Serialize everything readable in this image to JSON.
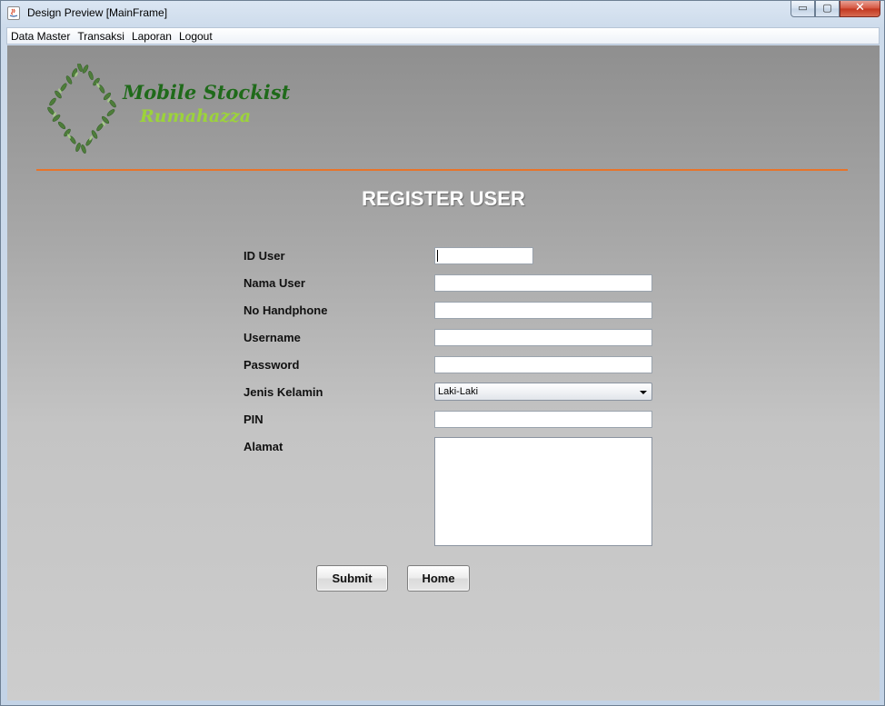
{
  "window": {
    "title": "Design Preview [MainFrame]",
    "controls": {
      "minimize": "▭",
      "maximize": "▢",
      "close": "✕"
    }
  },
  "menubar": {
    "items": [
      "Data Master",
      "Transaksi",
      "Laporan",
      "Logout"
    ]
  },
  "branding": {
    "line1": "Mobile Stockist",
    "line2": "Rumahazza",
    "colors": {
      "line1": "#1f6a1a",
      "line2": "#9cd33a",
      "divider": "#e8742a"
    },
    "logo_icon": "leaf-wreath-icon"
  },
  "form": {
    "title": "REGISTER USER",
    "labels": {
      "id_user": "ID User",
      "nama_user": "Nama User",
      "no_handphone": "No Handphone",
      "username": "Username",
      "password": "Password",
      "jenis_kelamin": "Jenis Kelamin",
      "pin": "PIN",
      "alamat": "Alamat"
    },
    "values": {
      "id_user": "",
      "nama_user": "",
      "no_handphone": "",
      "username": "",
      "password": "",
      "jenis_kelamin": "Laki-Laki",
      "pin": "",
      "alamat": ""
    },
    "buttons": {
      "submit": "Submit",
      "home": "Home"
    }
  }
}
